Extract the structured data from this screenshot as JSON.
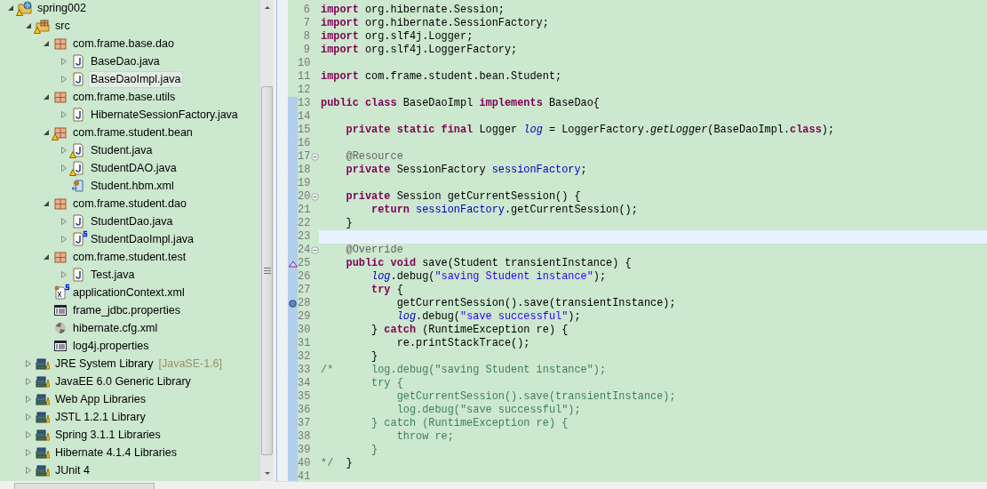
{
  "project_explorer": {
    "tree": [
      {
        "label": "spring002",
        "kind": "project",
        "warning": true,
        "spring": false,
        "expanded": true,
        "selected": false,
        "children": [
          {
            "label": "src",
            "kind": "folder",
            "warning": true,
            "spring": false,
            "expanded": true,
            "selected": false,
            "children": [
              {
                "label": "com.frame.base.dao",
                "kind": "package",
                "warning": false,
                "spring": false,
                "expanded": true,
                "selected": false,
                "children": [
                  {
                    "label": "BaseDao.java",
                    "kind": "java",
                    "warning": false,
                    "spring": false,
                    "expanded": false,
                    "selected": false
                  },
                  {
                    "label": "BaseDaoImpl.java",
                    "kind": "java",
                    "warning": false,
                    "spring": false,
                    "expanded": false,
                    "selected": true
                  }
                ]
              },
              {
                "label": "com.frame.base.utils",
                "kind": "package",
                "warning": false,
                "spring": false,
                "expanded": true,
                "selected": false,
                "children": [
                  {
                    "label": "HibernateSessionFactory.java",
                    "kind": "java",
                    "warning": false,
                    "spring": false,
                    "expanded": false,
                    "selected": false
                  }
                ]
              },
              {
                "label": "com.frame.student.bean",
                "kind": "package",
                "warning": true,
                "spring": false,
                "expanded": true,
                "selected": false,
                "children": [
                  {
                    "label": "Student.java",
                    "kind": "java",
                    "warning": true,
                    "spring": false,
                    "expanded": false,
                    "selected": false
                  },
                  {
                    "label": "StudentDAO.java",
                    "kind": "java",
                    "warning": true,
                    "spring": false,
                    "expanded": false,
                    "selected": false
                  },
                  {
                    "label": "Student.hbm.xml",
                    "kind": "mapping",
                    "warning": false,
                    "spring": false,
                    "selected": false
                  }
                ]
              },
              {
                "label": "com.frame.student.dao",
                "kind": "package",
                "warning": false,
                "spring": false,
                "expanded": true,
                "selected": false,
                "children": [
                  {
                    "label": "StudentDao.java",
                    "kind": "java",
                    "warning": false,
                    "spring": false,
                    "expanded": false,
                    "selected": false
                  },
                  {
                    "label": "StudentDaoImpl.java",
                    "kind": "java",
                    "warning": false,
                    "spring": true,
                    "expanded": false,
                    "selected": false
                  }
                ]
              },
              {
                "label": "com.frame.student.test",
                "kind": "package",
                "warning": false,
                "spring": false,
                "expanded": true,
                "selected": false,
                "children": [
                  {
                    "label": "Test.java",
                    "kind": "java",
                    "warning": false,
                    "spring": false,
                    "expanded": false,
                    "selected": false
                  }
                ]
              },
              {
                "label": "applicationContext.xml",
                "kind": "xml",
                "warning": false,
                "spring": true,
                "selected": false
              },
              {
                "label": "frame_jdbc.properties",
                "kind": "properties",
                "warning": false,
                "spring": false,
                "selected": false
              },
              {
                "label": "hibernate.cfg.xml",
                "kind": "config",
                "warning": false,
                "spring": false,
                "selected": false
              },
              {
                "label": "log4j.properties",
                "kind": "properties",
                "warning": false,
                "spring": false,
                "selected": false
              }
            ]
          },
          {
            "label": "JRE System Library",
            "qualifier": "[JavaSE-1.6]",
            "kind": "library",
            "warning": false,
            "spring": false,
            "expanded": false,
            "selected": false
          },
          {
            "label": "JavaEE 6.0 Generic Library",
            "kind": "library",
            "warning": false,
            "spring": false,
            "expanded": false,
            "selected": false
          },
          {
            "label": "Web App Libraries",
            "kind": "library",
            "warning": false,
            "spring": false,
            "expanded": false,
            "selected": false
          },
          {
            "label": "JSTL 1.2.1 Library",
            "kind": "library",
            "warning": false,
            "spring": false,
            "expanded": false,
            "selected": false
          },
          {
            "label": "Spring 3.1.1 Libraries",
            "kind": "library",
            "warning": false,
            "spring": false,
            "expanded": false,
            "selected": false
          },
          {
            "label": "Hibernate 4.1.4 Libraries",
            "kind": "library",
            "warning": false,
            "spring": false,
            "expanded": false,
            "selected": false
          },
          {
            "label": "JUnit 4",
            "kind": "library",
            "warning": false,
            "spring": false,
            "expanded": false,
            "selected": false
          }
        ]
      }
    ]
  },
  "editor": {
    "lines": [
      {
        "number": "6",
        "in_range": false,
        "foldable": false,
        "current": false,
        "override": false,
        "breakpoint": false,
        "tokens": [
          {
            "kind": "keyword",
            "text": "import"
          },
          {
            "kind": "plain",
            "text": " org.hibernate.Session;"
          }
        ]
      },
      {
        "number": "7",
        "in_range": false,
        "foldable": false,
        "current": false,
        "override": false,
        "breakpoint": false,
        "tokens": [
          {
            "kind": "keyword",
            "text": "import"
          },
          {
            "kind": "plain",
            "text": " org.hibernate.SessionFactory;"
          }
        ]
      },
      {
        "number": "8",
        "in_range": false,
        "foldable": false,
        "current": false,
        "override": false,
        "breakpoint": false,
        "tokens": [
          {
            "kind": "keyword",
            "text": "import"
          },
          {
            "kind": "plain",
            "text": " org.slf4j.Logger;"
          }
        ]
      },
      {
        "number": "9",
        "in_range": false,
        "foldable": false,
        "current": false,
        "override": false,
        "breakpoint": false,
        "tokens": [
          {
            "kind": "keyword",
            "text": "import"
          },
          {
            "kind": "plain",
            "text": " org.slf4j.LoggerFactory;"
          }
        ]
      },
      {
        "number": "10",
        "in_range": false,
        "foldable": false,
        "current": false,
        "override": false,
        "breakpoint": false
      },
      {
        "number": "11",
        "in_range": false,
        "foldable": false,
        "current": false,
        "override": false,
        "breakpoint": false,
        "tokens": [
          {
            "kind": "keyword",
            "text": "import"
          },
          {
            "kind": "plain",
            "text": " com.frame.student.bean.Student;"
          }
        ]
      },
      {
        "number": "12",
        "in_range": false,
        "foldable": false,
        "current": false,
        "override": false,
        "breakpoint": false
      },
      {
        "number": "13",
        "in_range": true,
        "foldable": false,
        "current": false,
        "override": false,
        "breakpoint": false,
        "tokens": [
          {
            "kind": "keyword",
            "text": "public class"
          },
          {
            "kind": "plain",
            "text": " BaseDaoImpl "
          },
          {
            "kind": "keyword",
            "text": "implements"
          },
          {
            "kind": "plain",
            "text": " BaseDao{"
          }
        ]
      },
      {
        "number": "14",
        "in_range": true,
        "foldable": false,
        "current": false,
        "override": false,
        "breakpoint": false
      },
      {
        "number": "15",
        "in_range": true,
        "foldable": false,
        "current": false,
        "override": false,
        "breakpoint": false,
        "tokens": [
          {
            "kind": "keyword",
            "text": "    private static final"
          },
          {
            "kind": "plain",
            "text": " Logger "
          },
          {
            "kind": "static-field",
            "text": "log"
          },
          {
            "kind": "plain",
            "text": " = LoggerFactory."
          },
          {
            "kind": "static-method",
            "text": "getLogger"
          },
          {
            "kind": "plain",
            "text": "(BaseDaoImpl."
          },
          {
            "kind": "keyword",
            "text": "class"
          },
          {
            "kind": "plain",
            "text": ");"
          }
        ]
      },
      {
        "number": "16",
        "in_range": true,
        "foldable": false,
        "current": false,
        "override": false,
        "breakpoint": false
      },
      {
        "number": "17",
        "in_range": true,
        "foldable": true,
        "current": false,
        "override": false,
        "breakpoint": false,
        "tokens": [
          {
            "kind": "annotation",
            "text": "    @Resource"
          }
        ]
      },
      {
        "number": "18",
        "in_range": true,
        "foldable": false,
        "current": false,
        "override": false,
        "breakpoint": false,
        "tokens": [
          {
            "kind": "keyword",
            "text": "    private"
          },
          {
            "kind": "plain",
            "text": " SessionFactory "
          },
          {
            "kind": "field",
            "text": "sessionFactory"
          },
          {
            "kind": "plain",
            "text": ";"
          }
        ]
      },
      {
        "number": "19",
        "in_range": true,
        "foldable": false,
        "current": false,
        "override": false,
        "breakpoint": false
      },
      {
        "number": "20",
        "in_range": true,
        "foldable": true,
        "current": false,
        "override": false,
        "breakpoint": false,
        "tokens": [
          {
            "kind": "keyword",
            "text": "    private"
          },
          {
            "kind": "plain",
            "text": " Session getCurrentSession() {"
          }
        ]
      },
      {
        "number": "21",
        "in_range": true,
        "foldable": false,
        "current": false,
        "override": false,
        "breakpoint": false,
        "tokens": [
          {
            "kind": "keyword",
            "text": "        return "
          },
          {
            "kind": "field",
            "text": "sessionFactory"
          },
          {
            "kind": "plain",
            "text": ".getCurrentSession();"
          }
        ]
      },
      {
        "number": "22",
        "in_range": true,
        "foldable": false,
        "current": false,
        "override": false,
        "breakpoint": false,
        "tokens": [
          {
            "kind": "plain",
            "text": "    }"
          }
        ]
      },
      {
        "number": "23",
        "in_range": true,
        "foldable": false,
        "current": true,
        "override": false,
        "breakpoint": false
      },
      {
        "number": "24",
        "in_range": true,
        "foldable": true,
        "current": false,
        "override": false,
        "breakpoint": false,
        "tokens": [
          {
            "kind": "annotation",
            "text": "    @Override"
          }
        ]
      },
      {
        "number": "25",
        "in_range": true,
        "foldable": false,
        "current": false,
        "override": true,
        "breakpoint": false,
        "tokens": [
          {
            "kind": "keyword",
            "text": "    public void"
          },
          {
            "kind": "plain",
            "text": " save(Student transientInstance) {"
          }
        ]
      },
      {
        "number": "26",
        "in_range": true,
        "foldable": false,
        "current": false,
        "override": false,
        "breakpoint": false,
        "tokens": [
          {
            "kind": "static-field",
            "text": "        log"
          },
          {
            "kind": "plain",
            "text": ".debug("
          },
          {
            "kind": "string",
            "text": "\"saving Student instance\""
          },
          {
            "kind": "plain",
            "text": ");"
          }
        ]
      },
      {
        "number": "27",
        "in_range": true,
        "foldable": false,
        "current": false,
        "override": false,
        "breakpoint": false,
        "tokens": [
          {
            "kind": "keyword",
            "text": "        try"
          },
          {
            "kind": "plain",
            "text": " {"
          }
        ]
      },
      {
        "number": "28",
        "in_range": true,
        "foldable": false,
        "current": false,
        "override": false,
        "breakpoint": true,
        "tokens": [
          {
            "kind": "plain",
            "text": "            getCurrentSession().save(transientInstance);"
          }
        ]
      },
      {
        "number": "29",
        "in_range": true,
        "foldable": false,
        "current": false,
        "override": false,
        "breakpoint": false,
        "tokens": [
          {
            "kind": "static-field",
            "text": "            log"
          },
          {
            "kind": "plain",
            "text": ".debug("
          },
          {
            "kind": "string",
            "text": "\"save successful\""
          },
          {
            "kind": "plain",
            "text": ");"
          }
        ]
      },
      {
        "number": "30",
        "in_range": true,
        "foldable": false,
        "current": false,
        "override": false,
        "breakpoint": false,
        "tokens": [
          {
            "kind": "plain",
            "text": "        } "
          },
          {
            "kind": "keyword",
            "text": "catch"
          },
          {
            "kind": "plain",
            "text": " (RuntimeException re) {"
          }
        ]
      },
      {
        "number": "31",
        "in_range": true,
        "foldable": false,
        "current": false,
        "override": false,
        "breakpoint": false,
        "tokens": [
          {
            "kind": "plain",
            "text": "            re.printStackTrace();"
          }
        ]
      },
      {
        "number": "32",
        "in_range": true,
        "foldable": false,
        "current": false,
        "override": false,
        "breakpoint": false,
        "tokens": [
          {
            "kind": "plain",
            "text": "        }"
          }
        ]
      },
      {
        "number": "33",
        "in_range": true,
        "foldable": false,
        "current": false,
        "override": false,
        "breakpoint": false,
        "tokens": [
          {
            "kind": "comment",
            "text": "/*      log.debug(\"saving Student instance\");"
          }
        ]
      },
      {
        "number": "34",
        "in_range": true,
        "foldable": false,
        "current": false,
        "override": false,
        "breakpoint": false,
        "tokens": [
          {
            "kind": "comment",
            "text": "        try {"
          }
        ]
      },
      {
        "number": "35",
        "in_range": true,
        "foldable": false,
        "current": false,
        "override": false,
        "breakpoint": false,
        "tokens": [
          {
            "kind": "comment",
            "text": "            getCurrentSession().save(transientInstance);"
          }
        ]
      },
      {
        "number": "36",
        "in_range": true,
        "foldable": false,
        "current": false,
        "override": false,
        "breakpoint": false,
        "tokens": [
          {
            "kind": "comment",
            "text": "            log.debug(\"save successful\");"
          }
        ]
      },
      {
        "number": "37",
        "in_range": true,
        "foldable": false,
        "current": false,
        "override": false,
        "breakpoint": false,
        "tokens": [
          {
            "kind": "comment",
            "text": "        } catch (RuntimeException re) {"
          }
        ]
      },
      {
        "number": "38",
        "in_range": true,
        "foldable": false,
        "current": false,
        "override": false,
        "breakpoint": false,
        "tokens": [
          {
            "kind": "comment",
            "text": "            throw re;"
          }
        ]
      },
      {
        "number": "39",
        "in_range": true,
        "foldable": false,
        "current": false,
        "override": false,
        "breakpoint": false,
        "tokens": [
          {
            "kind": "comment",
            "text": "        }"
          }
        ]
      },
      {
        "number": "40",
        "in_range": true,
        "foldable": false,
        "current": false,
        "override": false,
        "breakpoint": false,
        "tokens": [
          {
            "kind": "comment",
            "text": "*/"
          },
          {
            "kind": "plain",
            "text": "  }"
          }
        ]
      },
      {
        "number": "41",
        "in_range": true,
        "foldable": false,
        "current": false,
        "override": false,
        "breakpoint": false
      }
    ]
  }
}
